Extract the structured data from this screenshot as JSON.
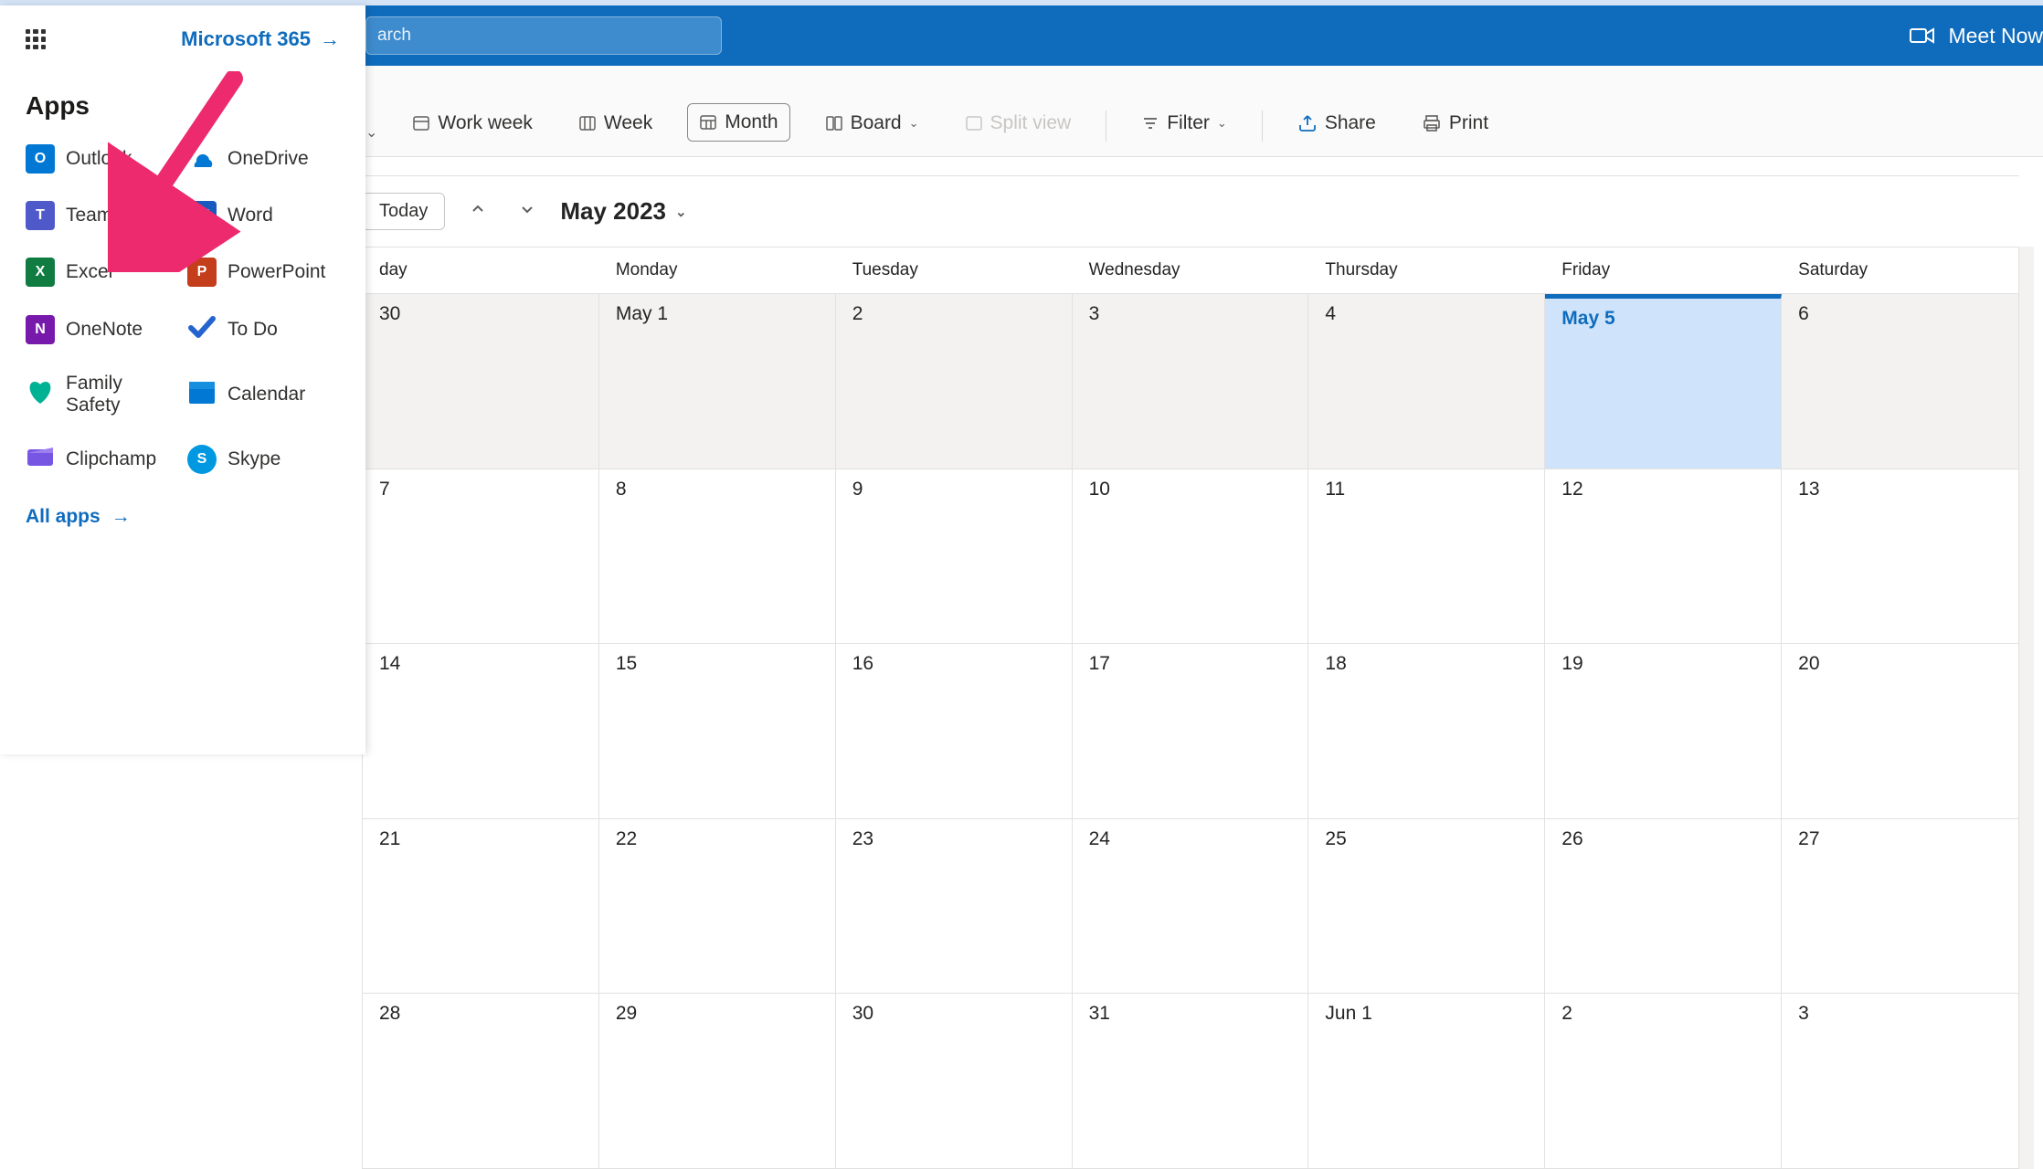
{
  "header": {
    "search_placeholder": "arch",
    "meet_now": "Meet Now"
  },
  "launcher": {
    "brand_link": "Microsoft 365",
    "apps_heading": "Apps",
    "all_apps": "All apps",
    "apps": [
      {
        "key": "outlook",
        "label": "Outlook",
        "bg": "#0078d4",
        "glyph": "O"
      },
      {
        "key": "onedrive",
        "label": "OneDrive",
        "bg": "#0078d4",
        "glyph": ""
      },
      {
        "key": "teams",
        "label": "Teams",
        "bg": "#5059c9",
        "glyph": "T"
      },
      {
        "key": "word",
        "label": "Word",
        "bg": "#185abd",
        "glyph": "W"
      },
      {
        "key": "excel",
        "label": "Excel",
        "bg": "#107c41",
        "glyph": "X"
      },
      {
        "key": "ppt",
        "label": "PowerPoint",
        "bg": "#c43e1c",
        "glyph": "P"
      },
      {
        "key": "onenote",
        "label": "OneNote",
        "bg": "#7719aa",
        "glyph": "N"
      },
      {
        "key": "todo",
        "label": "To Do",
        "bg": "#2564cf",
        "glyph": "✓"
      },
      {
        "key": "family",
        "label": "Family Safety",
        "bg": "#00a884",
        "glyph": "♥"
      },
      {
        "key": "calendar",
        "label": "Calendar",
        "bg": "#0078d4",
        "glyph": ""
      },
      {
        "key": "clipchamp",
        "label": "Clipchamp",
        "bg": "#7756e3",
        "glyph": ""
      },
      {
        "key": "skype",
        "label": "Skype",
        "bg": "#0099e1",
        "glyph": "S"
      }
    ]
  },
  "toolbar": {
    "work_week": "Work week",
    "week": "Week",
    "month": "Month",
    "board": "Board",
    "split_view": "Split view",
    "filter": "Filter",
    "share": "Share",
    "print": "Print"
  },
  "nav": {
    "today": "Today",
    "month_label": "May 2023"
  },
  "calendar": {
    "days": [
      "day",
      "Monday",
      "Tuesday",
      "Wednesday",
      "Thursday",
      "Friday",
      "Saturday"
    ],
    "weeks": [
      [
        {
          "label": "30",
          "prev": true
        },
        {
          "label": "May 1"
        },
        {
          "label": "2"
        },
        {
          "label": "3"
        },
        {
          "label": "4"
        },
        {
          "label": "May 5",
          "today": true
        },
        {
          "label": "6"
        }
      ],
      [
        {
          "label": "7"
        },
        {
          "label": "8"
        },
        {
          "label": "9"
        },
        {
          "label": "10"
        },
        {
          "label": "11"
        },
        {
          "label": "12"
        },
        {
          "label": "13"
        }
      ],
      [
        {
          "label": "14"
        },
        {
          "label": "15"
        },
        {
          "label": "16"
        },
        {
          "label": "17"
        },
        {
          "label": "18"
        },
        {
          "label": "19"
        },
        {
          "label": "20"
        }
      ],
      [
        {
          "label": "21"
        },
        {
          "label": "22"
        },
        {
          "label": "23"
        },
        {
          "label": "24"
        },
        {
          "label": "25"
        },
        {
          "label": "26"
        },
        {
          "label": "27"
        }
      ],
      [
        {
          "label": "28"
        },
        {
          "label": "29"
        },
        {
          "label": "30"
        },
        {
          "label": "31"
        },
        {
          "label": "Jun 1"
        },
        {
          "label": "2"
        },
        {
          "label": "3"
        }
      ]
    ]
  }
}
